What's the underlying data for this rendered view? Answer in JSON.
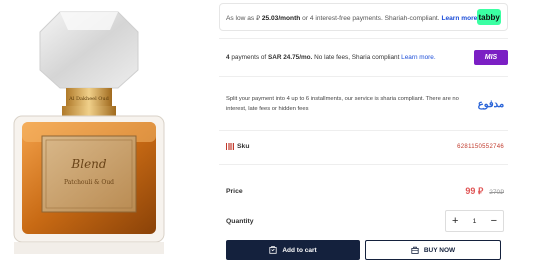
{
  "colors": {
    "tabby_green": "#3bffa3",
    "mis_purple": "#7b1fc4",
    "madfu_blue": "#2a64d8",
    "navy": "#14213d",
    "price_red": "#e05555",
    "sku_red": "#c0392b"
  },
  "tabby": {
    "text_prefix": "As low as",
    "currency_symbol": "⃁",
    "amount": "25.03/month",
    "text_suffix": "or 4 interest-free payments. Shariah-compliant.",
    "learn_more": "Learn more",
    "logo": "tabby"
  },
  "mis": {
    "count": "4",
    "text_mid": "payments of",
    "amount": "SAR 24.75/mo.",
    "text_suffix": "No late fees, Sharia compliant",
    "learn_more": "Learn more.",
    "logo": "MIS"
  },
  "madfu": {
    "text": "Split your payment into 4 up to 6 installments, our service is sharia compliant. There are no interest, late fees or hidden fees",
    "logo": "مدفوع"
  },
  "sku": {
    "label": "Sku",
    "value": "6281150552746",
    "icon": "barcode-icon"
  },
  "price": {
    "label": "Price",
    "current": "99",
    "currency_symbol": "⃁",
    "old": "270⃁"
  },
  "quantity": {
    "label": "Quantity",
    "value": "1",
    "plus": "+",
    "minus": "−"
  },
  "actions": {
    "add_to_cart": "Add to cart",
    "buy_now": "BUY NOW"
  },
  "product_image": {
    "bottle_label_line1": "Blend",
    "bottle_label_line2": "Patchouli & Oud",
    "neck_label": "Al Dakheel Oud"
  }
}
